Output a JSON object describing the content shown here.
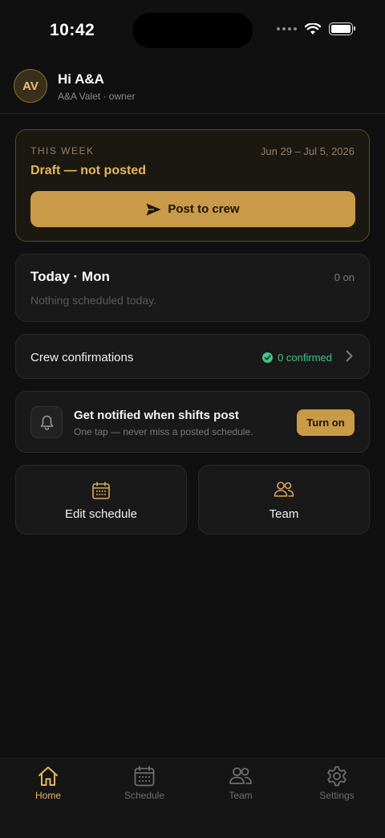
{
  "status_bar": {
    "time": "10:42"
  },
  "header": {
    "avatar_initials": "AV",
    "greeting": "Hi A&A",
    "subtitle": "A&A Valet · owner"
  },
  "week_card": {
    "label": "THIS WEEK",
    "range": "Jun 29 – Jul 5, 2026",
    "status": "Draft — not posted",
    "post_button_label": "Post to crew"
  },
  "today_card": {
    "title": "Today · Mon",
    "count": "0 on",
    "empty_message": "Nothing scheduled today."
  },
  "confirmations": {
    "label": "Crew confirmations",
    "status": "0 confirmed"
  },
  "notify_card": {
    "title": "Get notified when shifts post",
    "subtitle": "One tap — never miss a posted schedule.",
    "button_label": "Turn on"
  },
  "tiles": [
    {
      "label": "Edit schedule",
      "icon": "calendar-icon"
    },
    {
      "label": "Team",
      "icon": "people-icon"
    }
  ],
  "tab_bar": {
    "tabs": [
      {
        "label": "Home",
        "icon": "home-icon",
        "active": true
      },
      {
        "label": "Schedule",
        "icon": "calendar-icon",
        "active": false
      },
      {
        "label": "Team",
        "icon": "people-icon",
        "active": false
      },
      {
        "label": "Settings",
        "icon": "gear-icon",
        "active": false
      }
    ]
  },
  "colors": {
    "accent": "#c99a48",
    "accent_text": "#e3b65f",
    "success": "#3fc58a",
    "background": "#101010",
    "card": "#191919"
  }
}
